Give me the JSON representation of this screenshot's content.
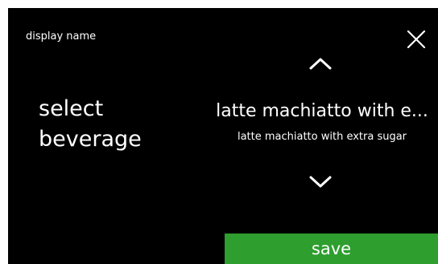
{
  "header": {
    "title": "display name",
    "close_icon": "close-icon"
  },
  "left_panel": {
    "label_line1": "select",
    "label_line2": "beverage"
  },
  "selector": {
    "up_icon": "chevron-up-icon",
    "down_icon": "chevron-down-icon",
    "value_truncated": "latte machiatto with e...",
    "value_full": "latte machiatto with extra sugar"
  },
  "footer": {
    "save_label": "save"
  },
  "colors": {
    "background": "#000000",
    "text": "#ffffff",
    "save_button": "#2e9e2e"
  }
}
